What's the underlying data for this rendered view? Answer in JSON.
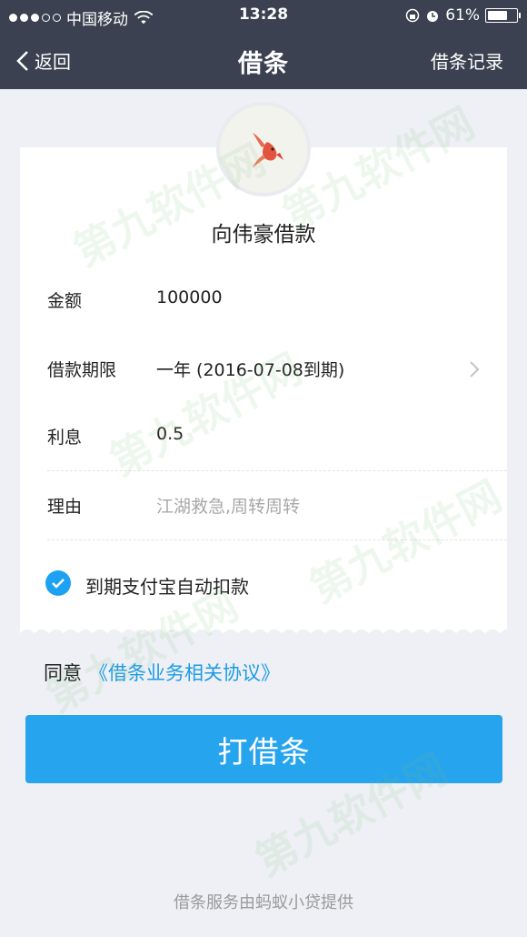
{
  "status_bar": {
    "carrier": "中国移动",
    "time": "13:28",
    "battery_percent": "61%",
    "battery_level": 0.61
  },
  "nav": {
    "back_label": "返回",
    "title": "借条",
    "records_label": "借条记录"
  },
  "loan": {
    "borrower_title": "向伟豪借款",
    "fields": [
      {
        "label": "金额",
        "value": "100000"
      },
      {
        "label": "借款期限",
        "value": "一年 (2016-07-08到期)"
      },
      {
        "label": "利息",
        "value": "0.5"
      },
      {
        "label": "理由",
        "placeholder": "江湖救急,周转周转"
      }
    ],
    "auto_pay_label": "到期支付宝自动扣款",
    "auto_pay_checked": true
  },
  "agreement": {
    "prefix": "同意",
    "link": "《借条业务相关协议》"
  },
  "submit_label": "打借条",
  "footer": "借条服务由蚂蚁小贷提供",
  "watermark": "第九软件网",
  "colors": {
    "nav_bg": "#3b4150",
    "accent": "#27a4ee",
    "link": "#1b9ce3",
    "page_bg": "#eef0f5"
  }
}
